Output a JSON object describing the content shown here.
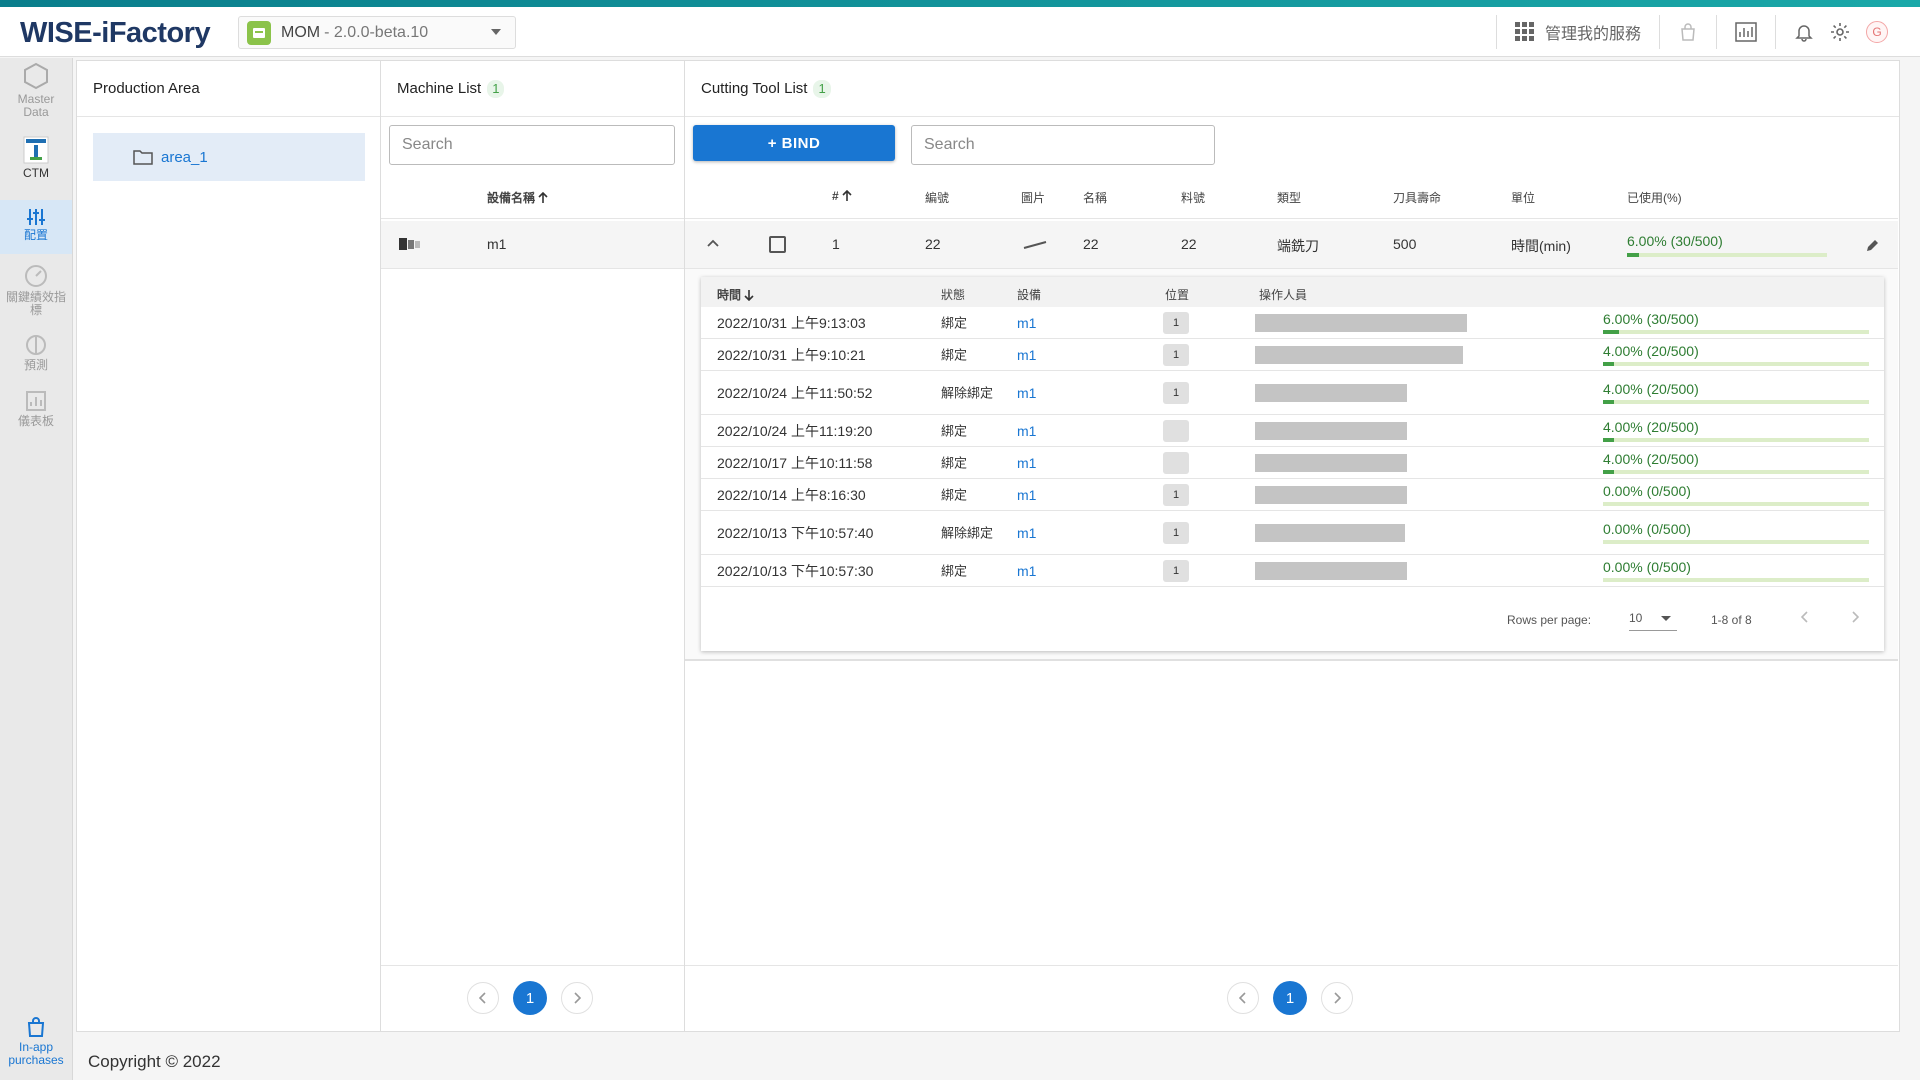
{
  "app": {
    "logo": "WISE-iFactory",
    "selector": {
      "name": "MOM",
      "version": "- 2.0.0-beta.10"
    }
  },
  "topbar": {
    "manage_services": "管理我的服務",
    "avatar_letter": "G"
  },
  "sidebar": {
    "items": [
      {
        "label": "Master Data",
        "icon": "hexagon-icon",
        "active": false
      },
      {
        "label": "CTM",
        "icon": "ctm-app-icon",
        "active": false
      },
      {
        "label": "配置",
        "icon": "sliders-icon",
        "active": true
      },
      {
        "label": "關鍵績效指標",
        "icon": "gauge-icon",
        "active": false
      },
      {
        "label": "預測",
        "icon": "predict-icon",
        "active": false
      },
      {
        "label": "儀表板",
        "icon": "dashboard-icon",
        "active": false
      }
    ],
    "bottom": {
      "label": "In-app purchases",
      "icon": "shopping-bag-icon"
    }
  },
  "production_area": {
    "title": "Production Area",
    "items": [
      {
        "label": "area_1"
      }
    ]
  },
  "machine_list": {
    "title": "Machine List",
    "count": "1",
    "search_placeholder": "Search",
    "column": "設備名稱",
    "rows": [
      {
        "name": "m1"
      }
    ],
    "page": "1"
  },
  "cutting_tool_list": {
    "title": "Cutting Tool List",
    "count": "1",
    "bind_label": "+ BIND",
    "search_placeholder": "Search",
    "columns": {
      "index": "#",
      "code": "編號",
      "image": "圖片",
      "name": "名稱",
      "part_no": "料號",
      "type": "類型",
      "life": "刀具壽命",
      "unit": "單位",
      "used": "已使用(%)"
    },
    "rows": [
      {
        "index": "1",
        "code": "22",
        "name": "22",
        "part_no": "22",
        "type": "端銑刀",
        "life": "500",
        "unit": "時間(min)",
        "used_text": "6.00% (30/500)",
        "used_pct": 6
      }
    ],
    "page": "1"
  },
  "history": {
    "columns": {
      "time": "時間",
      "status": "狀態",
      "machine": "設備",
      "position": "位置",
      "operator": "操作人員"
    },
    "rows": [
      {
        "time": "2022/10/31 上午9:13:03",
        "status": "綁定",
        "machine": "m1",
        "position": "1",
        "used_text": "6.00% (30/500)",
        "used_pct": 6
      },
      {
        "time": "2022/10/31 上午9:10:21",
        "status": "綁定",
        "machine": "m1",
        "position": "1",
        "used_text": "4.00% (20/500)",
        "used_pct": 4
      },
      {
        "time": "2022/10/24 上午11:50:52",
        "status": "解除綁定",
        "machine": "m1",
        "position": "1",
        "used_text": "4.00% (20/500)",
        "used_pct": 4
      },
      {
        "time": "2022/10/24 上午11:19:20",
        "status": "綁定",
        "machine": "m1",
        "position": "",
        "used_text": "4.00% (20/500)",
        "used_pct": 4
      },
      {
        "time": "2022/10/17 上午10:11:58",
        "status": "綁定",
        "machine": "m1",
        "position": "",
        "used_text": "4.00% (20/500)",
        "used_pct": 4
      },
      {
        "time": "2022/10/14 上午8:16:30",
        "status": "綁定",
        "machine": "m1",
        "position": "1",
        "used_text": "0.00% (0/500)",
        "used_pct": 0
      },
      {
        "time": "2022/10/13 下午10:57:40",
        "status": "解除綁定",
        "machine": "m1",
        "position": "1",
        "used_text": "0.00% (0/500)",
        "used_pct": 0
      },
      {
        "time": "2022/10/13 下午10:57:30",
        "status": "綁定",
        "machine": "m1",
        "position": "1",
        "used_text": "0.00% (0/500)",
        "used_pct": 0
      }
    ],
    "footer": {
      "rows_per_page_label": "Rows per page:",
      "rows_per_page": "10",
      "range": "1-8 of 8"
    }
  },
  "footer": {
    "copyright": "Copyright © 2022"
  },
  "colors": {
    "primary": "#1976d2",
    "success": "#43a047",
    "brand": "#1f3864"
  }
}
